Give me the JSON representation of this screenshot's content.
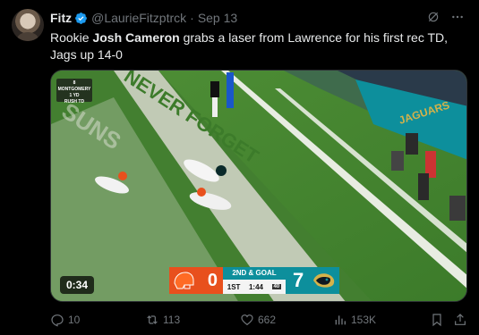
{
  "author": {
    "name": "Fitz",
    "handle": "@LaurieFitzptrck",
    "separator": "·",
    "date": "Sep 13"
  },
  "tweet": {
    "text_prefix": "Rookie ",
    "text_bold": "Josh Cameron",
    "text_suffix": " grabs a laser from Lawrence for his first rec TD, Jags up 14-0"
  },
  "video": {
    "duration": "0:34",
    "overlay_lines": [
      "8 MONTGOMERY",
      "1 YD",
      "RUSH TD"
    ],
    "endzone_text": "NEVER FORGET",
    "endzone_text_2": "JAGUARS",
    "scorebug": {
      "home_score": "0",
      "down_distance": "2ND & GOAL",
      "quarter": "1ST",
      "clock": "1:44",
      "play_clock": "40",
      "away_score": "7"
    },
    "colors": {
      "browns": "#e8501d",
      "jaguars": "#0d8f9c",
      "field": "#3a7a2a"
    }
  },
  "actions": {
    "replies": "10",
    "reposts": "113",
    "likes": "662",
    "views": "153K"
  }
}
